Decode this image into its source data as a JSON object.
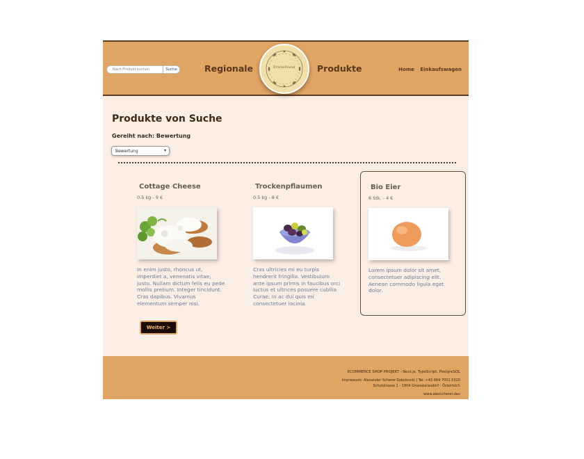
{
  "colors": {
    "header_bg": "#e0a463",
    "page_bg": "#fbefe5",
    "text_dark": "#3f2a18",
    "desc_text": "#6b7a96"
  },
  "search": {
    "placeholder": "Nach Produkt suchen",
    "button": "Suche"
  },
  "brand": {
    "left": "Regionale",
    "right": "Produkte",
    "logo_text": "ErnteDank"
  },
  "nav": {
    "home": "Home",
    "cart": "Einkaufswagen"
  },
  "main": {
    "title": "Produkte von Suche",
    "sort_label": "Gereiht nach: Bewertung",
    "sort_value": "Bewertung"
  },
  "products": [
    {
      "name": "Cottage Cheese",
      "meta": "0.5 kg - 9 €",
      "image": "cottage-cheese-photo",
      "description": "In enim justo, rhoncus ut, imperdiet a, venenatis vitae, justo. Nullam dictum felis eu pede mollis pretium. Integer tincidunt. Cras dapibus. Vivamus elementum semper nisi."
    },
    {
      "name": "Trockenpflaumen",
      "meta": "0.5 kg - 8 €",
      "image": "plums-bowl-photo",
      "description": "Cras ultricies mi eu turpis hendrerit fringilla. Vestibulum ante ipsum primis in faucibus orci luctus et ultrices posuere cubilia Curae; In ac dui quis mi consectetuer lacinia."
    },
    {
      "name": "Bio Eier",
      "meta": "6 Stk. - 4 €",
      "image": "egg-photo",
      "description": "Lorem ipsum dolor sit amet, consectetuer adipiscing elit. Aenean commodo ligula eget dolor."
    }
  ],
  "pagination": {
    "next": "Weiter >"
  },
  "footer": {
    "line1": "ECOMMERCE SHOP PROJEKT - Next.js, TypeScript, PostgreSQL",
    "line2": "Impressum: Alexander Scherer-Sokolovski | Tel: +43 664 7001 0320",
    "line3": "Schulstrasse 1 - 1904 Grosswarasdorf - Österreich",
    "line4": "www.alexscherer.dev"
  }
}
